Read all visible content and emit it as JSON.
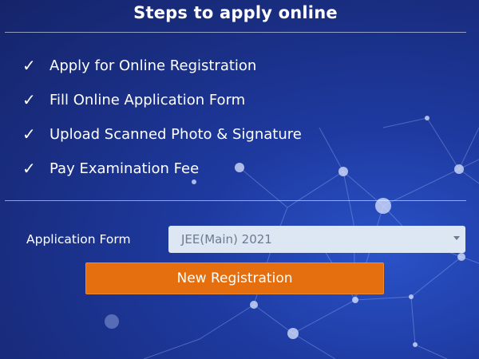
{
  "header": {
    "title": "Steps to apply online"
  },
  "steps": [
    {
      "label": "Apply for Online Registration",
      "icon": "checkmark-icon"
    },
    {
      "label": "Fill Online Application Form",
      "icon": "checkmark-icon"
    },
    {
      "label": "Upload Scanned Photo & Signature",
      "icon": "checkmark-icon"
    },
    {
      "label": "Pay Examination Fee",
      "icon": "checkmark-icon"
    }
  ],
  "form": {
    "label": "Application Form",
    "selected": "JEE(Main) 2021"
  },
  "button": {
    "label": "New Registration"
  },
  "colors": {
    "background": "#1e3aa0",
    "button": "#e56f0e",
    "select_bg": "#dde6f3",
    "text": "#ffffff"
  }
}
